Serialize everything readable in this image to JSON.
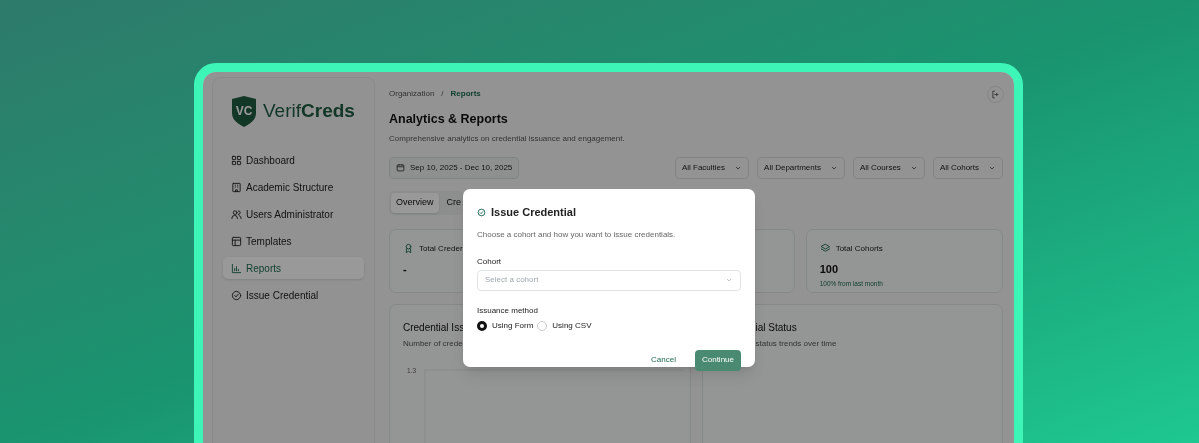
{
  "brand": {
    "mark": "VC",
    "name": "Verif**Creds**"
  },
  "sidebar": {
    "items": [
      {
        "label": "Dashboard",
        "selected": false
      },
      {
        "label": "Academic Structure",
        "selected": false
      },
      {
        "label": "Users Administrator",
        "selected": false
      },
      {
        "label": "Templates",
        "selected": false
      },
      {
        "label": "Reports",
        "selected": true
      },
      {
        "label": "Issue Credential",
        "selected": false
      }
    ]
  },
  "breadcrumb": {
    "items": [
      "Organization",
      "Reports"
    ],
    "separator": "/"
  },
  "header": {
    "title": "Analytics & Reports",
    "subtitle": "Comprehensive analytics on credential issuance and engagement."
  },
  "date_range": "Sep 10, 2025 - Dec 10, 2025",
  "filters": [
    "All Faculties",
    "All Departments",
    "All Courses",
    "All Cohorts"
  ],
  "tabs": [
    {
      "label": "Overview",
      "selected": true
    },
    {
      "label": "Cre",
      "selected": false
    }
  ],
  "stat_cards": [
    {
      "label": "Total Creder",
      "value": "-"
    },
    {
      "label": "Total Cohorts",
      "value": "100",
      "change": "100% from last month"
    }
  ],
  "chart_cards": [
    {
      "title": "Credential Iss",
      "subtitle": "Number of crede",
      "y_tick": "1.3"
    },
    {
      "title": "ial Status",
      "subtitle": "status trends over time"
    }
  ],
  "dialog": {
    "title": "Issue Credential",
    "description": "Choose a cohort and how you want to issue credentials.",
    "cohort_label": "Cohort",
    "cohort_placeholder": "Select a cohort",
    "method_label": "Issuance method",
    "methods": [
      {
        "label": "Using Form",
        "selected": true
      },
      {
        "label": "Using CSV",
        "selected": false
      }
    ],
    "buttons": [
      {
        "label": "Cancel",
        "kind": "ghost"
      },
      {
        "label": "Continue",
        "kind": "primary"
      }
    ]
  }
}
